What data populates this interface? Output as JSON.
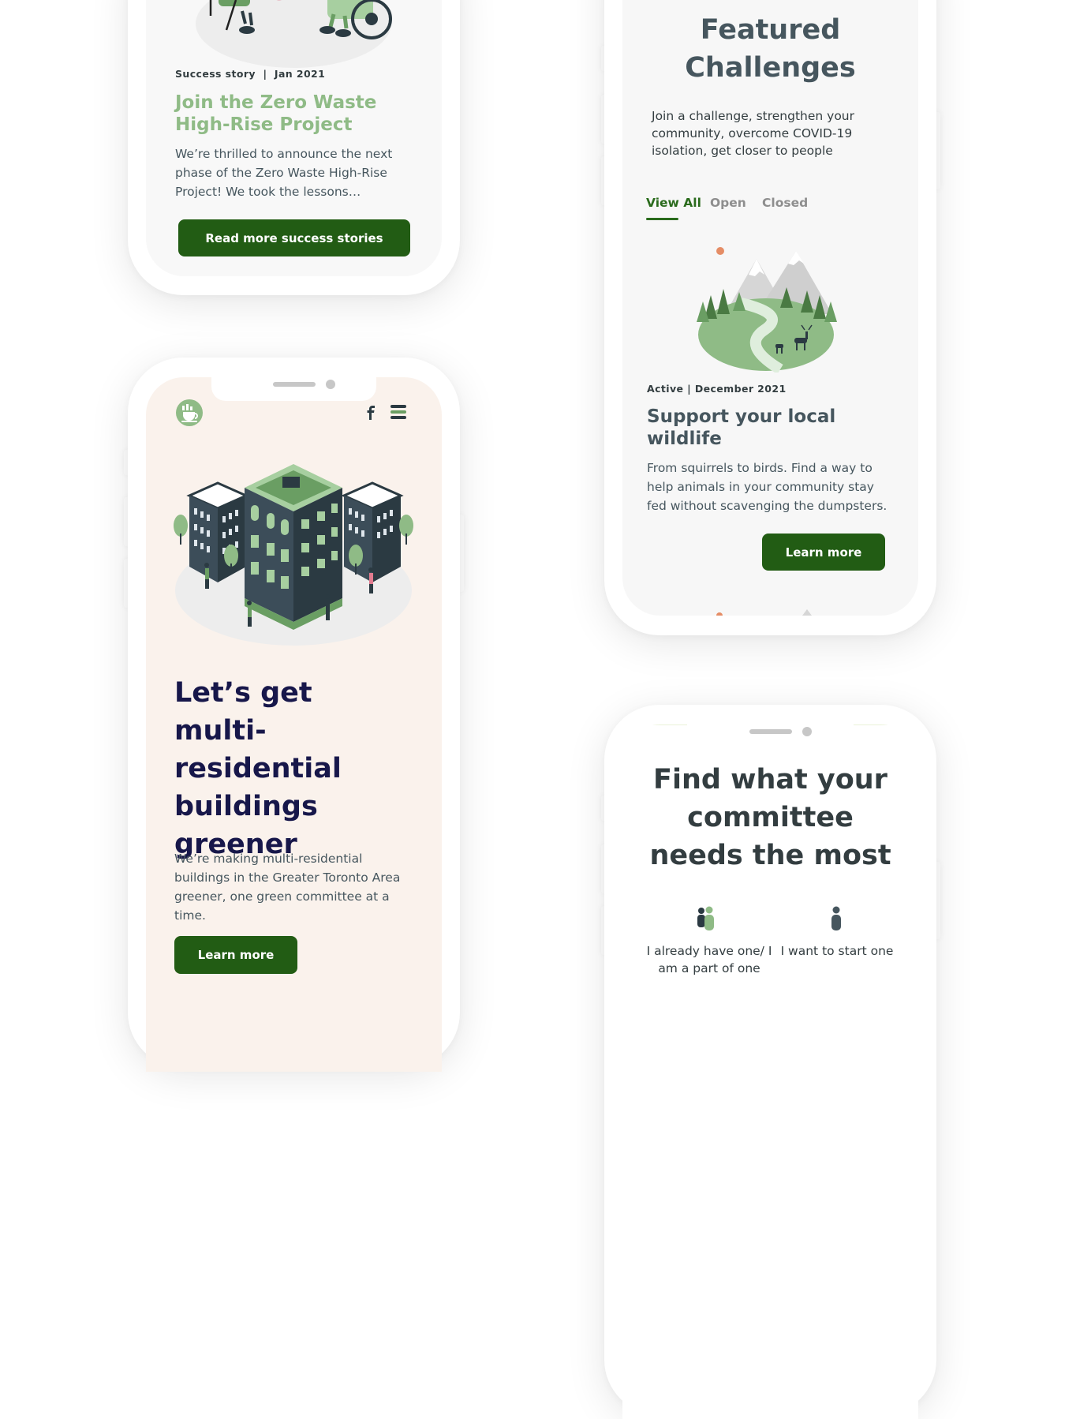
{
  "success_card": {
    "meta": "Success story  |  Jan 2021",
    "title": "Join the Zero Waste High-Rise Project",
    "body": "We’re thrilled to announce the next phase of the Zero Waste High-Rise Project! We took the lessons…",
    "button": "Read more success stories"
  },
  "hero": {
    "title": "Let’s get multi-residential buildings greener",
    "body": "We’re making multi-residential buildings in the Greater Toronto Area greener, one green committee at a time.",
    "button": "Learn more",
    "header_icons": [
      "logo-icon",
      "facebook-icon",
      "hamburger-menu-icon"
    ]
  },
  "challenges": {
    "title": "Featured Challenges",
    "subtitle": "Join a challenge, strengthen your community, overcome COVID-19 isolation, get closer to people",
    "tabs": [
      {
        "label": "View All",
        "active": true
      },
      {
        "label": "Open",
        "active": false
      },
      {
        "label": "Closed",
        "active": false
      }
    ],
    "card": {
      "meta": "Active | December 2021",
      "title": "Support your local wildlife",
      "body": "From squirrels to birds. Find a way to help animals in your community stay fed without scavenging the dumpsters.",
      "button": "Learn more"
    }
  },
  "committee": {
    "title": "Find what your committee needs the most",
    "options": [
      {
        "label": "I already have one/ I am a part of one",
        "icon": "group-people-icon"
      },
      {
        "label": "I want to start one",
        "icon": "person-icon"
      }
    ]
  },
  "colors": {
    "primary_green": "#225c14",
    "light_green": "#8fbb86",
    "navy": "#17174a",
    "slate": "#46565e",
    "hero_bg": "#faf2ec",
    "card_bg": "#f7f7f7",
    "accent_orange": "#e58d66"
  }
}
